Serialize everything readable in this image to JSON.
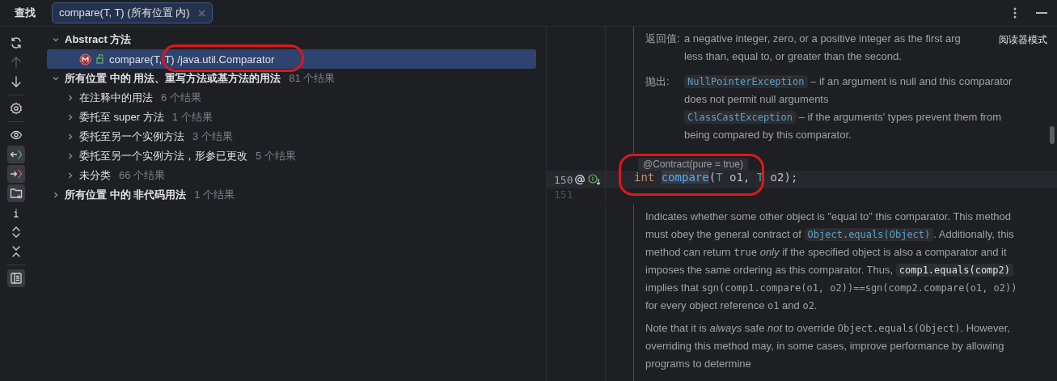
{
  "toolbar": {
    "title": "查找",
    "tab": {
      "label": "compare(T, T) (所有位置 内)",
      "selected": true
    }
  },
  "side_tools": [
    [
      {
        "kind": "refresh",
        "on": false,
        "disabled": false
      },
      {
        "kind": "up",
        "on": false,
        "disabled": true
      },
      {
        "kind": "down",
        "on": false,
        "disabled": false
      }
    ],
    [
      {
        "kind": "settings",
        "on": false,
        "disabled": false
      }
    ],
    [
      {
        "kind": "eye",
        "on": false,
        "disabled": false
      },
      {
        "kind": "read",
        "on": true,
        "disabled": false
      },
      {
        "kind": "write",
        "on": true,
        "disabled": false
      },
      {
        "kind": "folder",
        "on": true,
        "disabled": false
      },
      {
        "kind": "info",
        "on": false,
        "disabled": false
      },
      {
        "kind": "expand",
        "on": false,
        "disabled": false
      },
      {
        "kind": "collapse",
        "on": false,
        "disabled": false
      }
    ],
    [
      {
        "kind": "preview",
        "on": true,
        "disabled": false
      }
    ]
  ],
  "tree": [
    {
      "label": "Abstract 方法",
      "expanded": true,
      "children": [
        {
          "kind": "method",
          "label": "compare(T, T) /java.util.Comparator",
          "selected": true
        }
      ]
    },
    {
      "label": "所有位置 中的 用法、重写方法或基方法的用法",
      "count": "81 个结果",
      "expanded": true,
      "children": [
        {
          "label": "在注释中的用法",
          "count": "6 个结果",
          "expanded": false
        },
        {
          "label": "委托至 super 方法",
          "count": "1 个结果",
          "expanded": false
        },
        {
          "label": "委托至另一个实例方法",
          "count": "3 个结果",
          "expanded": false
        },
        {
          "label": "委托至另一个实例方法，形参已更改",
          "count": "5 个结果",
          "expanded": false
        },
        {
          "label": "未分类",
          "count": "66 个结果",
          "expanded": false
        }
      ]
    },
    {
      "label": "所有位置 中的 非代码用法",
      "count": "1 个结果",
      "expanded": false
    }
  ],
  "reader_mode": "阅读器模式",
  "doc_top": [
    {
      "label": "返回值:",
      "lines": [
        [
          {
            "kind": "text",
            "text": "a negative integer, zero, or a positive integer as the first arg"
          }
        ],
        [
          {
            "kind": "text",
            "text": "less than, equal to, or greater than the second."
          }
        ]
      ]
    },
    {
      "label": "抛出:",
      "lines": [
        [
          {
            "kind": "link",
            "text": "NullPointerException"
          },
          {
            "kind": "text",
            "text": " – if an argument is null and this comparator"
          }
        ],
        [
          {
            "kind": "text",
            "text": "does not permit null arguments"
          }
        ],
        [
          {
            "kind": "link",
            "text": "ClassCastException"
          },
          {
            "kind": "text",
            "text": " – if the arguments' types prevent them from"
          }
        ],
        [
          {
            "kind": "text",
            "text": "being compared by this comparator."
          }
        ]
      ]
    }
  ],
  "code": {
    "inlay": "@Contract(pure = true)",
    "lines": [
      {
        "number": "150",
        "annotated": true,
        "implemented": true,
        "tokens": [
          {
            "kind": "keyword",
            "text": "int"
          },
          {
            "kind": "method",
            "text": "compare"
          },
          {
            "kind": "plain",
            "text": "("
          },
          {
            "kind": "type",
            "text": "T"
          },
          {
            "kind": "plain",
            "text": " o1, "
          },
          {
            "kind": "type",
            "text": "T"
          },
          {
            "kind": "plain",
            "text": " o2);"
          }
        ]
      },
      {
        "number": "151",
        "annotated": false,
        "implemented": false
      }
    ]
  },
  "doc_bottom": [
    [
      {
        "kind": "text",
        "text": "Indicates whether some other object is \"equal to\" this comparator. This method must obey the general contract of "
      },
      {
        "kind": "link",
        "text": "Object.equals(Object)"
      },
      {
        "kind": "text",
        "text": ". Additionally, this method can return "
      },
      {
        "kind": "mono",
        "text": "true"
      },
      {
        "kind": "text",
        "text": " *only* if the specified object is also a comparator and it imposes the same ordering as this comparator. Thus, "
      },
      {
        "kind": "chip",
        "text": "comp1.equals(comp2)"
      },
      {
        "kind": "text",
        "text": " implies that "
      },
      {
        "kind": "mono",
        "text": "sgn(comp1.compare(o1, o2))==sgn(comp2.compare(o1, o2))"
      },
      {
        "kind": "text",
        "text": " for every object reference "
      },
      {
        "kind": "mono",
        "text": "o1"
      },
      {
        "kind": "text",
        "text": " and "
      },
      {
        "kind": "mono",
        "text": "o2"
      },
      {
        "kind": "text",
        "text": "."
      }
    ],
    [
      {
        "kind": "text",
        "text": "Note that it is *always* safe *not* to override "
      },
      {
        "kind": "mono",
        "text": "Object.equals(Object)"
      },
      {
        "kind": "text",
        "text": ". However, overriding this method may, in some cases, improve performance by allowing programs to determine"
      }
    ]
  ]
}
